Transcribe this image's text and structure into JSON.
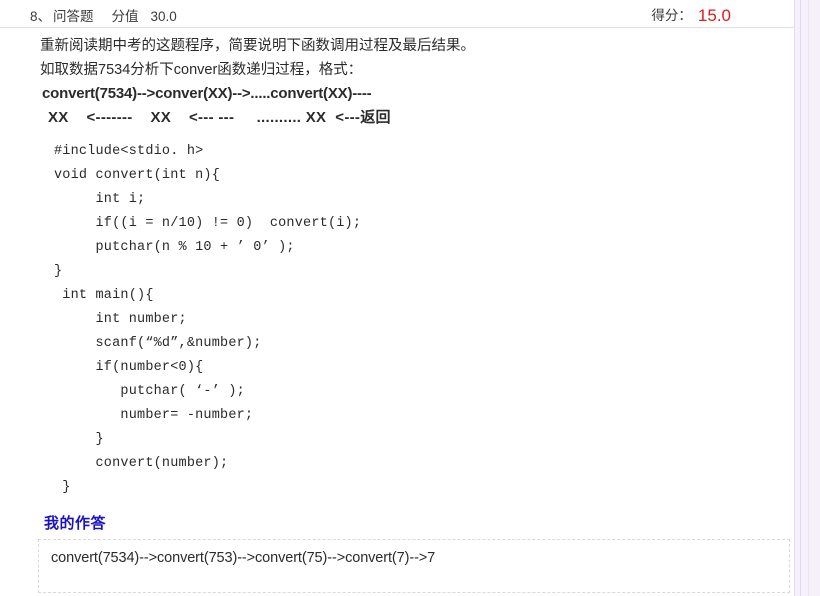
{
  "header": {
    "question_number": "8、",
    "question_type": "问答题",
    "score_label": "分值",
    "score_value": "30.0",
    "got_label": "得分：",
    "got_value": "15.0",
    "got_color": "#e01b1b"
  },
  "question": {
    "lines": [
      "重新阅读期中考的这题程序，简要说明下函数调用过程及最后结果。",
      "如取数据7534分析下conver函数递归过程，格式："
    ],
    "format_line_1": "convert(7534)-->conver(XX)-->.....convert(XX)----",
    "format_line_2": "XX    <-------    XX    <--- ---     .......... XX  <---返回"
  },
  "code": {
    "lines": [
      "#include<stdio. h>",
      "void convert(int n){",
      "     int i;",
      "     if((i = n/10) != 0)  convert(i);",
      "     putchar(n % 10 + ’ 0’ );",
      "}",
      " int main(){",
      "     int number;",
      "     scanf(“%d”,&number);",
      "     if(number<0){",
      "        putchar( ‘-’ );",
      "        number= -number;",
      "     }",
      "     convert(number);",
      " }"
    ]
  },
  "answer": {
    "heading": "我的作答",
    "heading_color": "#1a13c4",
    "text": "convert(7534)-->convert(753)-->convert(75)-->convert(7)-->7"
  },
  "gutter": {
    "background": "#f6f0fa"
  }
}
